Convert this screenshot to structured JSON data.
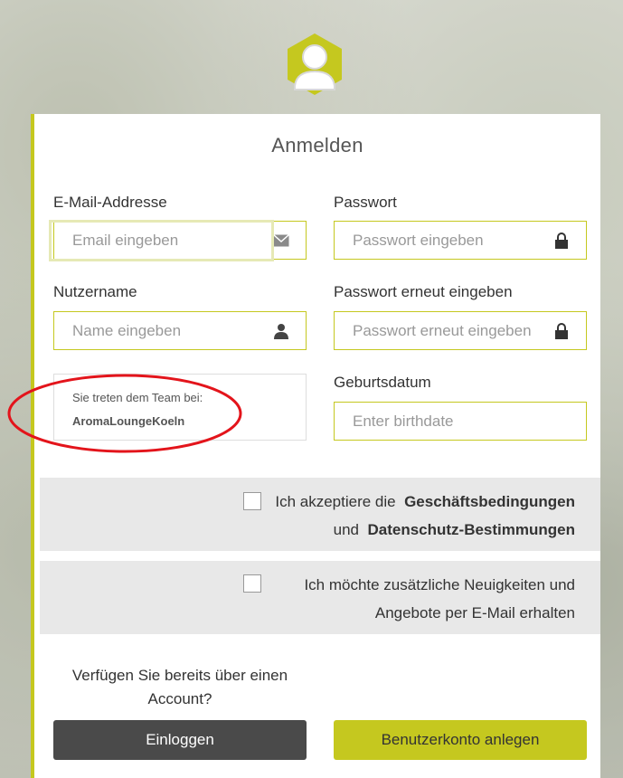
{
  "colors": {
    "accent": "#c5c81f",
    "dark_button": "#4a4a4a",
    "consent_bg": "#e8e8e8",
    "annotation": "#e3141b"
  },
  "header": {
    "avatar_icon": "user-avatar-icon"
  },
  "form": {
    "title": "Anmelden",
    "email": {
      "label": "E-Mail-Addresse",
      "placeholder": "Email eingeben",
      "icon": "envelope-icon"
    },
    "password": {
      "label": "Passwort",
      "placeholder": "Passwort eingeben",
      "icon": "lock-icon"
    },
    "username": {
      "label": "Nutzername",
      "placeholder": "Name eingeben",
      "icon": "user-icon"
    },
    "password_repeat": {
      "label": "Passwort erneut eingeben",
      "placeholder": "Passwort erneut eingeben",
      "icon": "lock-icon"
    },
    "team": {
      "caption": "Sie treten dem Team bei:",
      "name": "AromaLoungeKoeln"
    },
    "birthdate": {
      "label": "Geburtsdatum",
      "placeholder": "Enter birthdate"
    }
  },
  "consent_terms": {
    "line1_prefix": "Ich akzeptiere die",
    "line1_link": "Geschäftsbedingungen",
    "line2_prefix": "und",
    "line2_link": "Datenschutz-Bestimmungen",
    "checked": false
  },
  "consent_newsletter": {
    "line1": "Ich möchte zusätzliche Neuigkeiten und",
    "line2": "Angebote per E-Mail erhalten",
    "checked": false
  },
  "footer": {
    "account_question": "Verfügen Sie bereits über einen Account?",
    "login_label": "Einloggen",
    "register_label": "Benutzerkonto anlegen"
  }
}
